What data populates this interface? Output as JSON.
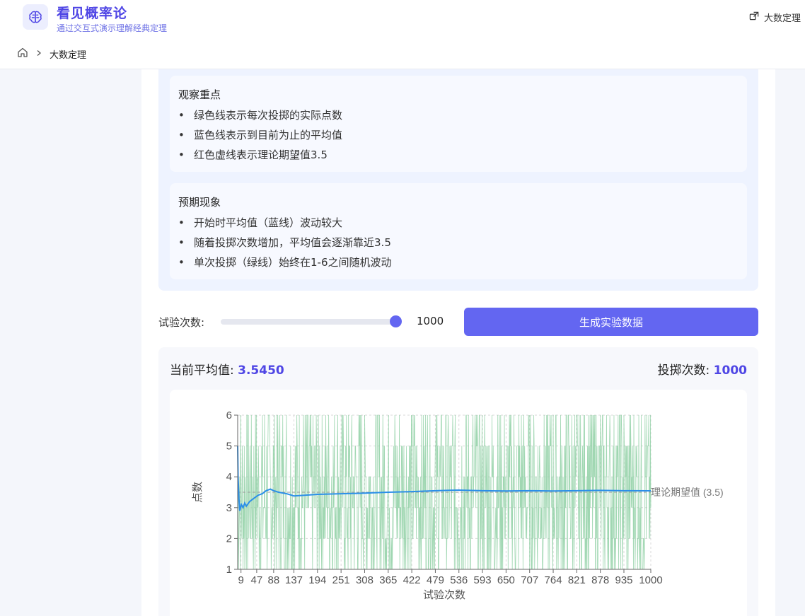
{
  "app": {
    "title": "看见概率论",
    "subtitle": "通过交互式演示理解经典定理",
    "exit_label": "大数定理"
  },
  "breadcrumb": {
    "current": "大数定理"
  },
  "observe": {
    "heading": "观察重点",
    "items": [
      "绿色线表示每次投掷的实际点数",
      "蓝色线表示到目前为止的平均值",
      "红色虚线表示理论期望值3.5"
    ]
  },
  "expect": {
    "heading": "预期现象",
    "items": [
      "开始时平均值（蓝线）波动较大",
      "随着投掷次数增加，平均值会逐渐靠近3.5",
      "单次投掷（绿线）始终在1-6之间随机波动"
    ]
  },
  "controls": {
    "trials_label": "试验次数:",
    "trials_value": "1000",
    "slider_fraction": 1.0,
    "generate_label": "生成实验数据"
  },
  "stats": {
    "mean_label": "当前平均值:",
    "mean_value": "3.5450",
    "count_label": "投掷次数:",
    "count_value": "1000"
  },
  "colors": {
    "accent": "#6366f1",
    "rolls": "#8fd0a4",
    "mean": "#2b8fe8",
    "expected": "#999999"
  },
  "chart_data": {
    "type": "line",
    "title": "",
    "xlabel": "试验次数",
    "ylabel": "点数",
    "xlim": [
      1,
      1000
    ],
    "ylim": [
      1,
      6
    ],
    "yticks": [
      1,
      2,
      3,
      4,
      5,
      6
    ],
    "xticks": [
      9,
      47,
      88,
      137,
      194,
      251,
      308,
      365,
      422,
      479,
      536,
      593,
      650,
      707,
      764,
      821,
      878,
      935,
      1000
    ],
    "reference_line": {
      "y": 3.5,
      "label": "理论期望值 (3.5)"
    },
    "grid": true,
    "series": [
      {
        "name": "",
        "kind": "rolls",
        "description_values": "1000 random die rolls in 1-6"
      },
      {
        "name": "",
        "kind": "running-mean",
        "x": [
          1,
          2,
          4,
          6,
          8,
          10,
          14,
          18,
          22,
          30,
          40,
          50,
          60,
          70,
          80,
          88,
          100,
          120,
          137,
          160,
          194,
          251,
          308,
          365,
          422,
          479,
          536,
          593,
          650,
          707,
          764,
          821,
          878,
          935,
          1000
        ],
        "values": [
          5.0,
          4.0,
          3.3,
          2.9,
          3.0,
          3.1,
          3.0,
          3.15,
          3.05,
          3.2,
          3.3,
          3.4,
          3.45,
          3.55,
          3.6,
          3.55,
          3.5,
          3.45,
          3.38,
          3.4,
          3.43,
          3.45,
          3.47,
          3.5,
          3.52,
          3.55,
          3.57,
          3.55,
          3.54,
          3.55,
          3.54,
          3.55,
          3.56,
          3.55,
          3.545
        ]
      }
    ]
  }
}
